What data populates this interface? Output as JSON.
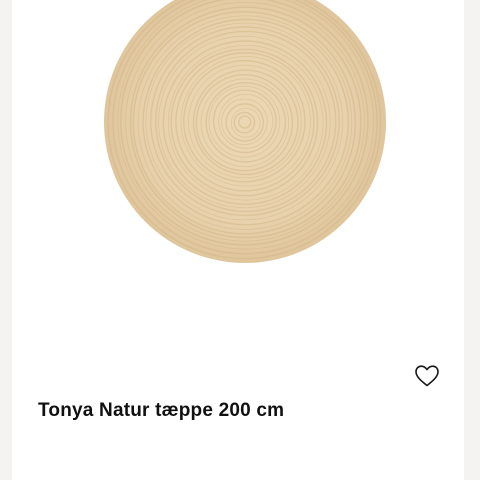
{
  "product": {
    "title": "Tonya Natur tæppe 200 cm",
    "image_icon": "round-jute-rug",
    "favorite_icon": "heart-outline-icon"
  },
  "colors": {
    "page_background": "#f4f3f1",
    "card_background": "#ffffff",
    "rug_base": "#e8d2ad",
    "rug_ring": "#d6bb8e",
    "text": "#111111"
  }
}
